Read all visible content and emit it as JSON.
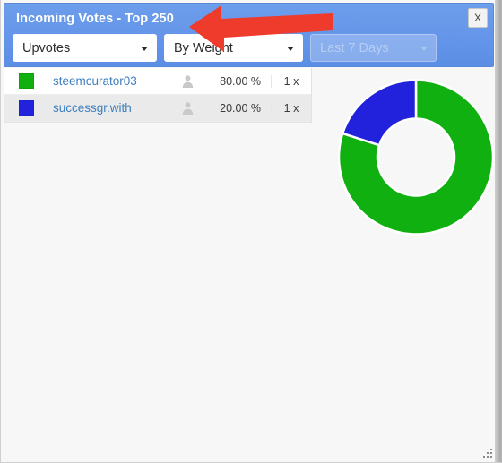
{
  "window": {
    "title": "Incoming Votes - Top 250",
    "close_label": "X",
    "close_icon": "close-icon",
    "resize_grip_icon": "resize-grip-icon",
    "header_color": "#6495ea",
    "title_color": "#ffffff"
  },
  "filters": [
    {
      "name": "vote-type",
      "value": "Upvotes",
      "disabled": false,
      "caret_icon": "chevron-down-icon"
    },
    {
      "name": "sort-mode",
      "value": "By Weight",
      "disabled": false,
      "caret_icon": "chevron-down-icon"
    },
    {
      "name": "date-range",
      "value": "Last 7 Days",
      "disabled": true,
      "caret_icon": "chevron-down-icon"
    }
  ],
  "table": {
    "rows": [
      {
        "color": "#11b011",
        "account": "steemcurator03",
        "avatar_icon": "person-icon",
        "percent": "80.00 %",
        "count": "1 x"
      },
      {
        "color": "#2222dd",
        "account": "successgr.with",
        "avatar_icon": "person-icon",
        "percent": "20.00 %",
        "count": "1 x"
      }
    ]
  },
  "annotation": {
    "shape": "left-arrow",
    "color": "#ef3b2c"
  },
  "chart_data": {
    "type": "pie",
    "variant": "donut",
    "title": "",
    "categories": [
      "steemcurator03",
      "successgr.with"
    ],
    "values": [
      80.0,
      20.0
    ],
    "labels": [
      "80.00 %",
      "20.00 %"
    ],
    "colors": [
      "#11b011",
      "#2222dd"
    ],
    "unit": "%",
    "start_angle_deg": 0,
    "direction": "clockwise",
    "inner_radius_ratio": 0.5,
    "legend": "none",
    "grid": false,
    "data_labels": false
  }
}
